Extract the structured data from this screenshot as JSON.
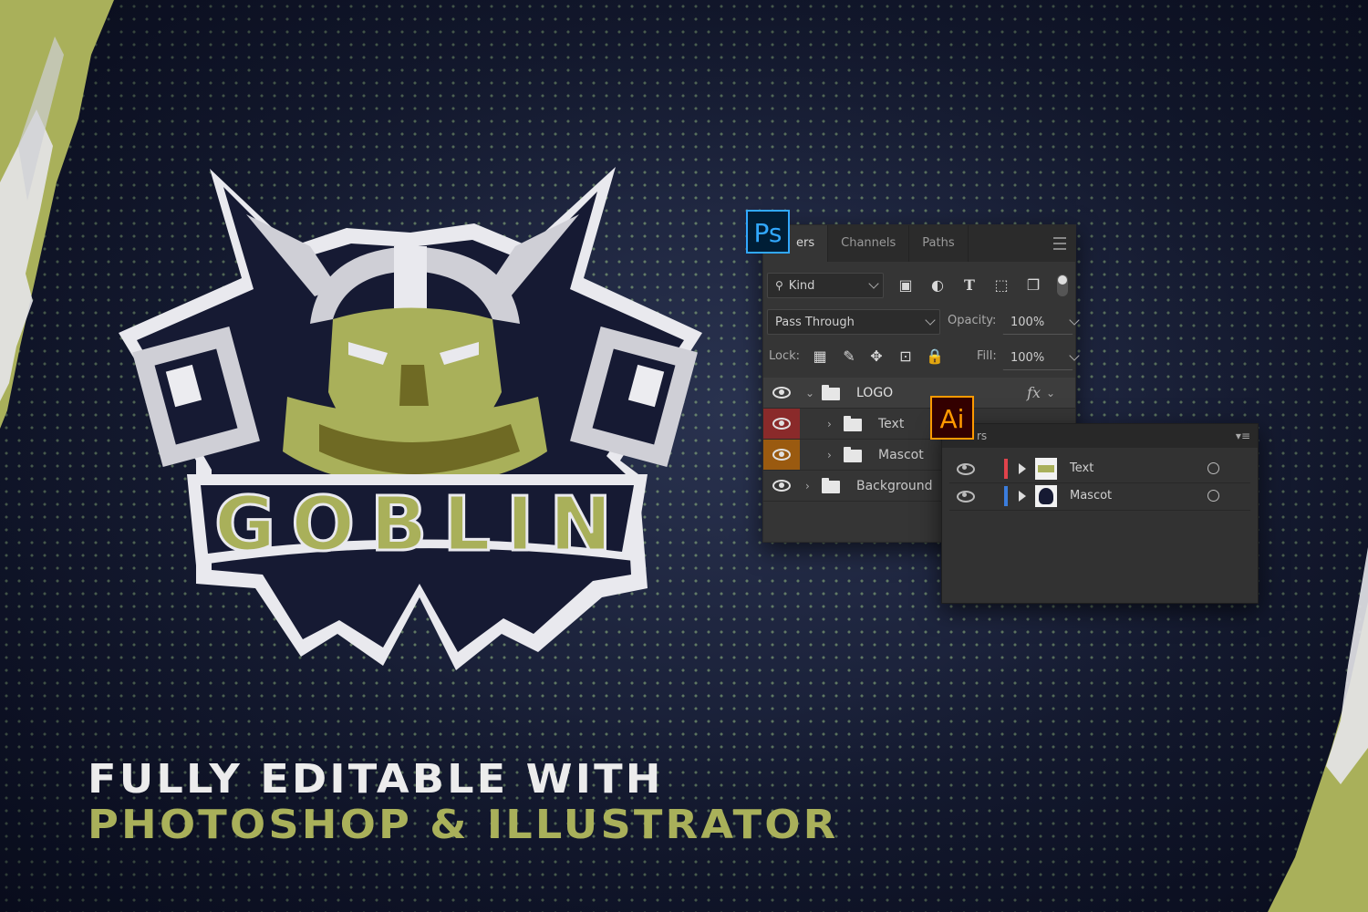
{
  "headline": {
    "line1": "FULLY EDITABLE WITH",
    "line2": "PHOTOSHOP & ILLUSTRATOR"
  },
  "logo": {
    "word": "GOBLIN",
    "colors": {
      "dark": "#161a33",
      "green": "#a9b05a",
      "olive": "#6f6a24",
      "silver": "#cfcfd6",
      "light": "#ececf0"
    }
  },
  "photoshop_panel": {
    "badge": "Ps",
    "badge_color": "#31a8ff",
    "tabs": [
      "ers",
      "Channels",
      "Paths"
    ],
    "filter_label": "Kind",
    "blend_mode": "Pass Through",
    "opacity_label": "Opacity:",
    "opacity_value": "100%",
    "lock_label": "Lock:",
    "fill_label": "Fill:",
    "fill_value": "100%",
    "fx_label": "fx",
    "layers": [
      {
        "name": "LOGO",
        "eye_bg": "",
        "expanded": true
      },
      {
        "name": "Text",
        "eye_bg": "#8a2a2a",
        "expanded": false
      },
      {
        "name": "Mascot",
        "eye_bg": "#9a5a10",
        "expanded": false
      },
      {
        "name": "Background",
        "eye_bg": "",
        "expanded": false
      }
    ]
  },
  "illustrator_panel": {
    "badge": "Ai",
    "badge_color": "#ff9a00",
    "title_fragment": "rs",
    "layers": [
      {
        "name": "Text",
        "color": "#e0434b"
      },
      {
        "name": "Mascot",
        "color": "#3b7ddd"
      }
    ]
  }
}
